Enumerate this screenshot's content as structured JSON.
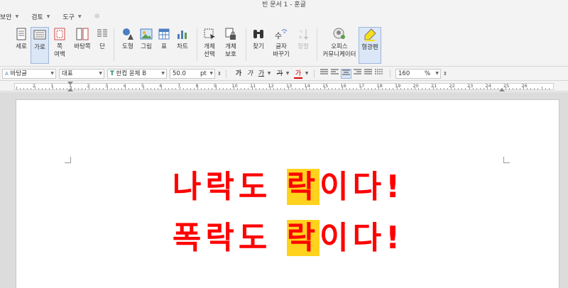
{
  "window": {
    "title": "빈 문서 1 - 훈글"
  },
  "menu": {
    "items": [
      {
        "label": "보안"
      },
      {
        "label": "검토"
      },
      {
        "label": "도구"
      }
    ]
  },
  "ribbon": {
    "buttons": [
      {
        "id": "sero",
        "label": "세로"
      },
      {
        "id": "garo",
        "label": "가로"
      },
      {
        "id": "jjok",
        "label": "쪽",
        "label2": "여백"
      },
      {
        "id": "batangjjok",
        "label": "바탕쪽"
      },
      {
        "id": "dan",
        "label": "단"
      },
      {
        "id": "dohyeong",
        "label": "도형"
      },
      {
        "id": "geurim",
        "label": "그림"
      },
      {
        "id": "pyo",
        "label": "표"
      },
      {
        "id": "chateu",
        "label": "차트"
      },
      {
        "id": "gaeche-seontaek",
        "label": "개체",
        "label2": "선택"
      },
      {
        "id": "gaeche-boho",
        "label": "개체",
        "label2": "보호"
      },
      {
        "id": "chatgi",
        "label": "찾기"
      },
      {
        "id": "geulja-bakkugi",
        "label": "글자",
        "label2": "바꾸기"
      },
      {
        "id": "jeongryeol",
        "label": "정렬"
      },
      {
        "id": "office",
        "label": "오피스",
        "label2": "커뮤니케이터"
      },
      {
        "id": "hyeonggwangpen",
        "label": "형광펜"
      }
    ]
  },
  "format": {
    "style": "바탕글",
    "lang": "대표",
    "font": "한컴 윤체 B",
    "size": "50.0",
    "unit": "pt",
    "zoom": "160",
    "zoom_unit": "%",
    "bold": "가",
    "italic": "가",
    "underline": "가",
    "strike": "가",
    "color": "가"
  },
  "ruler": {
    "numbers": [
      "2",
      "1",
      "1",
      "2",
      "3",
      "4",
      "5",
      "6",
      "7",
      "8",
      "9",
      "10",
      "11",
      "12",
      "13",
      "14",
      "15",
      "16",
      "17",
      "18",
      "19",
      "20",
      "21",
      "22",
      "23",
      "24",
      "25",
      "26"
    ]
  },
  "document": {
    "line1": {
      "before": "나락도 ",
      "highlight": "락",
      "after": "이다!"
    },
    "line2": {
      "before": "폭락도 ",
      "highlight": "락",
      "after": "이다!"
    }
  },
  "colors": {
    "text": "#ff0000",
    "highlight": "#ffd21e",
    "accent": "#2b579a"
  }
}
